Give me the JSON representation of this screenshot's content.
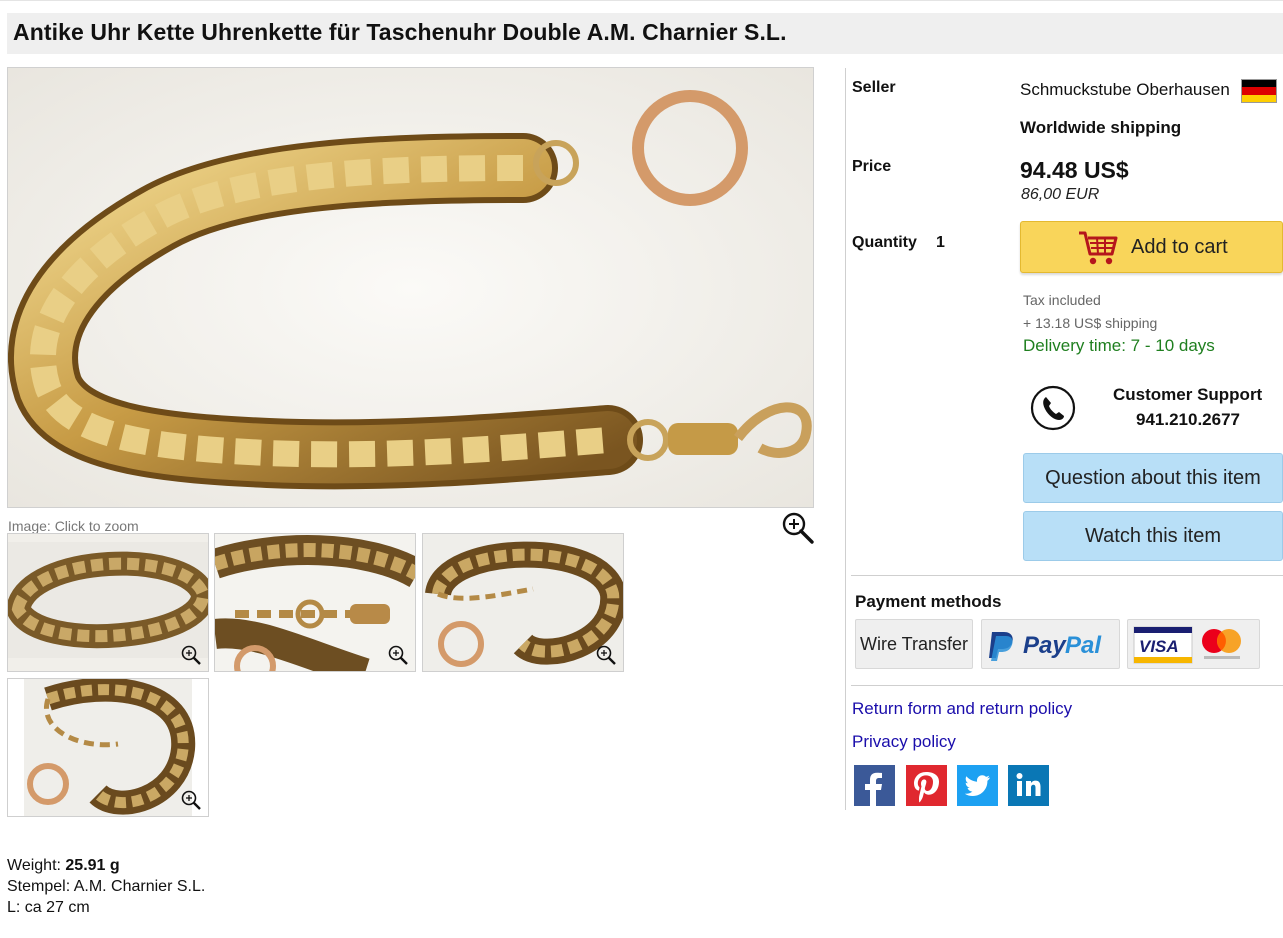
{
  "product": {
    "title": "Antike Uhr Kette Uhrenkette für Taschenuhr Double A.M. Charnier S.L.",
    "image_caption": "Image: Click to zoom",
    "details": {
      "weight_label": "Weight:",
      "weight_value": "25.91 g",
      "stamp_line": "Stempel: A.M. Charnier S.L.",
      "length_line": "L: ca 27 cm"
    }
  },
  "thumbnails": [
    "thumb-1",
    "thumb-2",
    "thumb-3",
    "thumb-4"
  ],
  "sidebar": {
    "seller_label": "Seller",
    "seller_name": "Schmuckstube Oberhausen",
    "seller_flag_colors": [
      "#000000",
      "#dd0000",
      "#ffce00"
    ],
    "shipping_note": "Worldwide shipping",
    "price_label": "Price",
    "price_main": "94.48 US$",
    "price_alt": "86,00 EUR",
    "quantity_label": "Quantity",
    "quantity_value": "1",
    "add_to_cart": "Add to cart",
    "tax_note": "Tax included",
    "shipping_cost": "+ 13.18 US$ shipping",
    "delivery": "Delivery time: 7 - 10 days",
    "support_title": "Customer Support",
    "support_phone": "941.210.2677",
    "question_button": "Question about this item",
    "watch_button": "Watch this item",
    "payment_title": "Payment methods",
    "payment_wire": "Wire Transfer",
    "payment_paypal_logo_text": "PayPal",
    "payment_card_logo_text": "VISA",
    "return_link": "Return form and return policy",
    "privacy_link": "Privacy policy",
    "social_icons": [
      "facebook-icon",
      "pinterest-icon",
      "twitter-icon",
      "linkedin-icon"
    ]
  },
  "colors": {
    "cart_button": "#f9d55a",
    "blue_button": "#b8dff7",
    "delivery_green": "#1f7f1f",
    "link_blue": "#1a0dab",
    "facebook": "#3b5998",
    "pinterest": "#e0282f",
    "twitter": "#1da1f2",
    "linkedin": "#0a77b5"
  }
}
